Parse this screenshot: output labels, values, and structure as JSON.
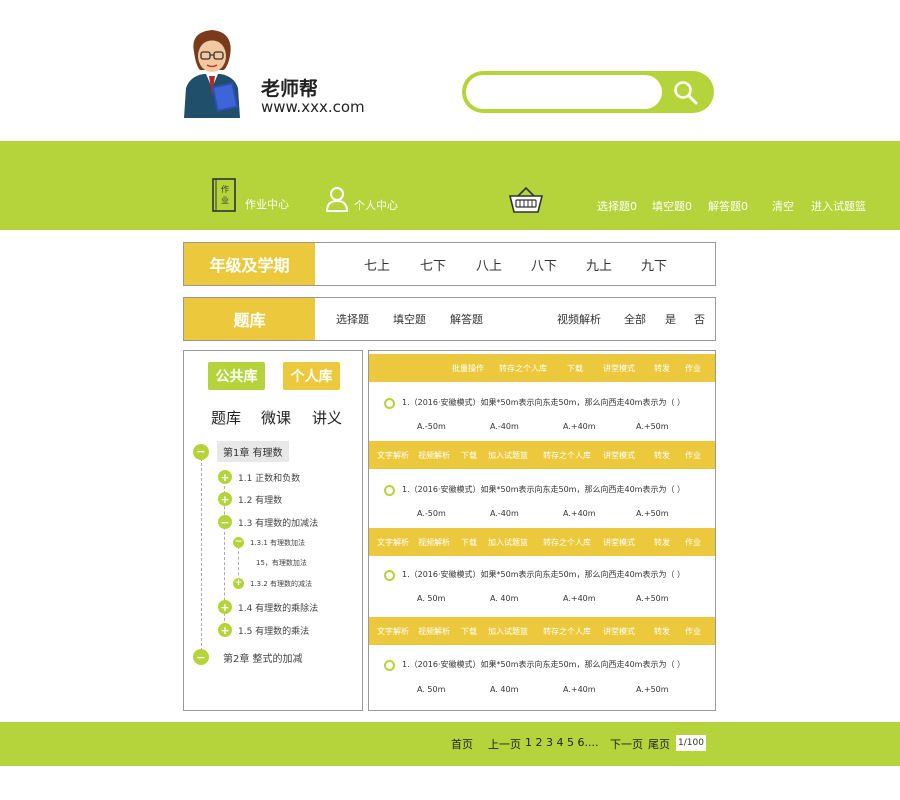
{
  "header": {
    "site_title": "老师帮",
    "site_url": "www.xxx.com",
    "search": {
      "placeholder": ""
    }
  },
  "nav": {
    "homework_center": "作业中心",
    "homework_icon_text": "作\n业",
    "personal_center": "个人中心",
    "choice": "选择题0",
    "fill": "填空题0",
    "answer": "解答题0",
    "clear": "清空",
    "enter_basket": "进入试题篮"
  },
  "grade_filter": {
    "label": "年级及学期",
    "options": [
      "七上",
      "七下",
      "八上",
      "八下",
      "九上",
      "九下"
    ]
  },
  "bank_filter": {
    "label": "题库",
    "types": [
      "选择题",
      "填空题",
      "解答题"
    ],
    "extras": [
      "视频解析",
      "全部",
      "是",
      "否"
    ]
  },
  "left_panel": {
    "public_lib": "公共库",
    "personal_lib": "个人库",
    "tabs": [
      "题库",
      "微课",
      "讲义"
    ],
    "chapter1": "第1章  有理数",
    "sections": [
      "1.1  正数和负数",
      "1.2  有理数",
      "1.3  有理数的加减法"
    ],
    "sub_1_3_1": "1.3.1  有理数加法",
    "sub_15": "15，有理数加法",
    "sub_1_3_2": "1.3.2  有理数的减法",
    "sections2": [
      "1.4  有理数的乘除法",
      "1.5  有理数的乘法"
    ],
    "chapter2": "第2章  整式的加减"
  },
  "questions": {
    "top_bar": [
      "批量操作",
      "转存之个人库",
      "下载",
      "讲堂模式",
      "转发",
      "作业"
    ],
    "action_bar": [
      "文字解析",
      "视频解析",
      "下载",
      "加入试题篮",
      "转存之个人库",
      "讲堂模式",
      "转发",
      "作业"
    ],
    "items": [
      {
        "text": "1.（2016·安徽模式）如果*50m表示向东走50m，那么向西走40m表示为（    ）",
        "options": [
          "A.-50m",
          "A.-40m",
          "A.+40m",
          "A.+50m"
        ]
      },
      {
        "text": "1.（2016·安徽模式）如果*50m表示向东走50m，那么向西走40m表示为（    ）",
        "options": [
          "A.-50m",
          "A.-40m",
          "A.+40m",
          "A.+50m"
        ]
      },
      {
        "text": "1.（2016·安徽模式）如果*50m表示向东走50m，那么向西走40m表示为（    ）",
        "options": [
          "A. 50m",
          "A. 40m",
          "A.+40m",
          "A.+50m"
        ]
      },
      {
        "text": "1.（2016·安徽模式）如果*50m表示向东走50m，那么向西走40m表示为（    ）",
        "options": [
          "A. 50m",
          "A. 40m",
          "A.+40m",
          "A.+50m"
        ]
      }
    ]
  },
  "pagination": {
    "first": "首页",
    "prev": "上一页",
    "pages": "1 2 3 4 5 6....",
    "next": "下一页",
    "last": "尾页",
    "current": "1/100"
  },
  "colors": {
    "green": "#b5d43b",
    "yellow": "#ecc93c"
  },
  "icons": [
    "teacher-avatar-icon",
    "search-icon",
    "homework-book-icon",
    "user-icon",
    "basket-icon",
    "plus-circle-icon",
    "minus-circle-icon",
    "radio-icon"
  ]
}
